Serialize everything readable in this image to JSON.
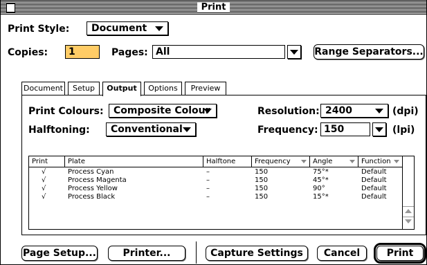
{
  "window": {
    "title": "Print"
  },
  "print_style": {
    "label": "Print Style:",
    "value": "Document"
  },
  "copies": {
    "label": "Copies:",
    "value": "1",
    "highlight_color": "#ffcc66"
  },
  "pages": {
    "label": "Pages:",
    "value": "All"
  },
  "range_separators_label": "Range Separators...",
  "tabs": [
    {
      "label": "Document"
    },
    {
      "label": "Setup"
    },
    {
      "label": "Output",
      "active": true
    },
    {
      "label": "Options"
    },
    {
      "label": "Preview"
    }
  ],
  "output": {
    "print_colours": {
      "label": "Print Colours:",
      "value": "Composite Colour"
    },
    "halftoning": {
      "label": "Halftoning:",
      "value": "Conventional"
    },
    "resolution": {
      "label": "Resolution:",
      "value": "2400",
      "unit": "(dpi)"
    },
    "frequency": {
      "label": "Frequency:",
      "value": "150",
      "unit": "(lpi)"
    }
  },
  "plate_table": {
    "headers": [
      "Print",
      "Plate",
      "Halftone",
      "Frequency",
      "Angle",
      "Function"
    ],
    "rows": [
      {
        "print": "√",
        "plate": "Process Cyan",
        "halftone": "–",
        "frequency": "150",
        "angle": "75°*",
        "function": "Default"
      },
      {
        "print": "√",
        "plate": "Process Magenta",
        "halftone": "–",
        "frequency": "150",
        "angle": "45°*",
        "function": "Default"
      },
      {
        "print": "√",
        "plate": "Process Yellow",
        "halftone": "–",
        "frequency": "150",
        "angle": "90°",
        "function": "Default"
      },
      {
        "print": "√",
        "plate": "Process Black",
        "halftone": "–",
        "frequency": "150",
        "angle": "15°*",
        "function": "Default"
      }
    ]
  },
  "buttons": {
    "page_setup": "Page Setup...",
    "printer": "Printer...",
    "capture_settings": "Capture Settings",
    "cancel": "Cancel",
    "print": "Print"
  }
}
